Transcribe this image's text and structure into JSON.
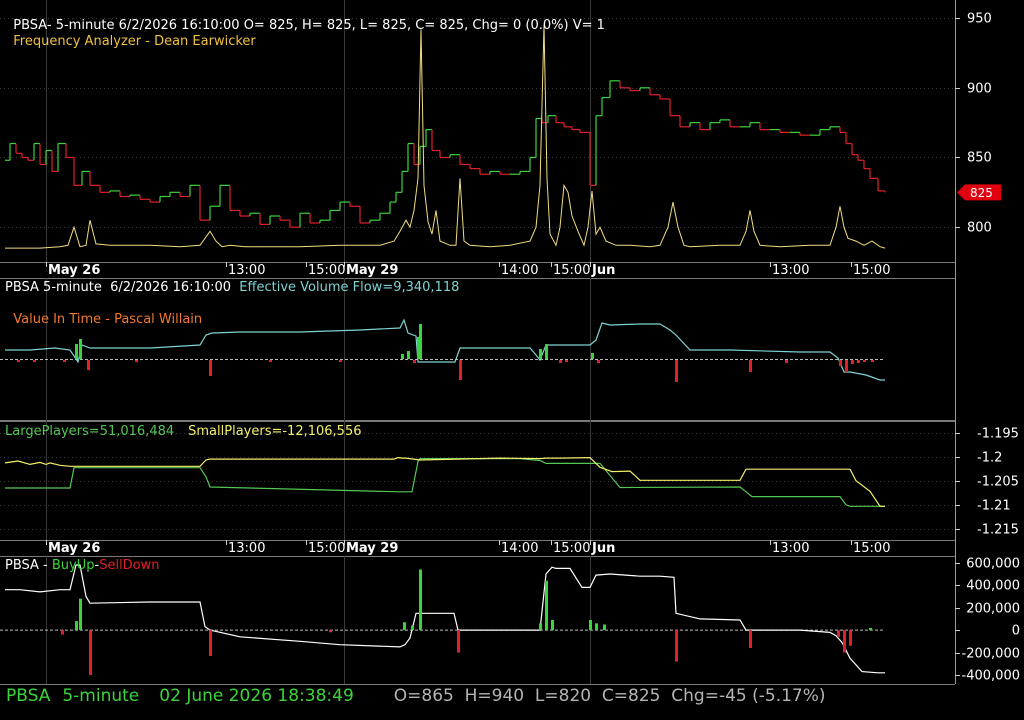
{
  "colors": {
    "background": "#000000",
    "grid": "#3a3a3a",
    "axis": "#cfcfcf",
    "up": "#3cd43c",
    "down": "#e0202a",
    "freq": "#f2dd80",
    "flow": "#7fd3d3",
    "small": "#f4f06a",
    "large": "#55c655",
    "white": "#ffffff",
    "header_title": "#ffffff",
    "header_sub": "#f0c040",
    "price_tag": "#e00010",
    "footer_green": "#3cd43c",
    "footer_grey": "#b4b4b4"
  },
  "panel1": {
    "title": "PBSA- 5-minute 6/2/2026 16:10:00 O= 825, H= 825, L= 825, C= 825, Chg= 0 (0.0%) V= 1",
    "subtitle": "Frequency Analyzer - Dean Earwicker"
  },
  "panel2": {
    "title_prefix": "PBSA 5-minute  6/2/2026 16:10:00  ",
    "title_value": "Effective Volume Flow=9,340,118",
    "subtitle": "Value In Time - Pascal Willain"
  },
  "panel3": {
    "large_label": "LargePlayers=51,016,484",
    "small_label": "SmallPlayers=-12,106,556"
  },
  "panel4": {
    "label_prefix": "PBSA - ",
    "label_up": "BuyUp",
    "label_sep": "-",
    "label_down": "SellDown"
  },
  "footer": {
    "symbol": "PBSA",
    "interval": "5-minute",
    "datetime": "02 June 2026 18:38:49",
    "stats": "O=865  H=940  L=820  C=825  Chg=-45 (-5.17%)"
  },
  "chart_data": [
    {
      "type": "line",
      "name": "price",
      "y_ticks": [
        950,
        900,
        850,
        800
      ],
      "ylim": [
        775,
        963
      ],
      "last_price_label": "825",
      "last_price": 825,
      "x_tick_labels": [
        "May 26",
        "13:00",
        "15:00",
        "May 29",
        "14:00",
        "15:00",
        "Jun",
        "13:00",
        "15:00"
      ],
      "x": [
        5,
        10,
        16,
        22,
        28,
        34,
        40,
        46,
        52,
        58,
        66,
        74,
        82,
        90,
        100,
        110,
        120,
        130,
        140,
        150,
        160,
        170,
        180,
        190,
        200,
        210,
        220,
        230,
        240,
        250,
        260,
        270,
        280,
        290,
        300,
        310,
        320,
        330,
        340,
        350,
        360,
        370,
        380,
        390,
        396,
        402,
        408,
        414,
        420,
        426,
        432,
        440,
        450,
        460,
        470,
        480,
        490,
        500,
        510,
        520,
        530,
        536,
        542,
        548,
        556,
        564,
        572,
        580,
        590,
        596,
        602,
        610,
        620,
        630,
        640,
        650,
        660,
        670,
        680,
        690,
        700,
        710,
        720,
        730,
        740,
        750,
        760,
        770,
        780,
        790,
        800,
        810,
        820,
        830,
        840,
        846,
        852,
        858,
        864,
        870,
        878,
        885
      ],
      "values": [
        848,
        860,
        853,
        850,
        848,
        860,
        845,
        855,
        840,
        860,
        850,
        830,
        840,
        830,
        825,
        826,
        822,
        823,
        820,
        818,
        822,
        825,
        822,
        830,
        805,
        815,
        830,
        812,
        808,
        810,
        802,
        808,
        805,
        800,
        810,
        803,
        805,
        812,
        818,
        815,
        803,
        805,
        810,
        818,
        825,
        840,
        860,
        845,
        858,
        870,
        855,
        850,
        852,
        845,
        842,
        838,
        840,
        838,
        838,
        840,
        850,
        878,
        875,
        880,
        875,
        872,
        870,
        868,
        830,
        880,
        893,
        905,
        900,
        898,
        900,
        895,
        892,
        880,
        872,
        875,
        870,
        875,
        877,
        872,
        872,
        875,
        870,
        870,
        868,
        868,
        866,
        866,
        870,
        872,
        868,
        860,
        852,
        848,
        842,
        835,
        826,
        825
      ]
    },
    {
      "type": "line",
      "name": "Frequency Analyzer",
      "x": [
        5,
        20,
        40,
        60,
        68,
        74,
        80,
        86,
        90,
        96,
        110,
        130,
        150,
        180,
        200,
        206,
        210,
        216,
        222,
        230,
        245,
        265,
        300,
        340,
        380,
        394,
        400,
        406,
        410,
        414,
        418,
        421,
        424,
        428,
        432,
        436,
        440,
        450,
        456,
        460,
        464,
        470,
        490,
        510,
        530,
        536,
        540,
        544,
        547,
        550,
        556,
        560,
        564,
        568,
        572,
        578,
        584,
        588,
        592,
        596,
        600,
        606,
        616,
        630,
        650,
        660,
        668,
        673,
        678,
        684,
        690,
        720,
        740,
        746,
        750,
        754,
        760,
        780,
        810,
        830,
        836,
        840,
        844,
        848,
        856,
        864,
        872,
        880,
        885
      ],
      "values": [
        785,
        785,
        785,
        786,
        787,
        800,
        786,
        787,
        805,
        788,
        787,
        787,
        787,
        786,
        787,
        793,
        797,
        790,
        786,
        787,
        786,
        786,
        786,
        787,
        787,
        790,
        797,
        805,
        800,
        812,
        835,
        942,
        830,
        804,
        795,
        812,
        790,
        787,
        787,
        835,
        790,
        787,
        786,
        787,
        790,
        800,
        830,
        945,
        835,
        795,
        787,
        800,
        830,
        825,
        808,
        797,
        787,
        800,
        826,
        795,
        800,
        790,
        787,
        787,
        786,
        787,
        800,
        818,
        800,
        787,
        786,
        787,
        787,
        797,
        812,
        797,
        787,
        786,
        787,
        787,
        800,
        815,
        800,
        792,
        790,
        787,
        790,
        786,
        785
      ]
    },
    {
      "type": "line",
      "name": "Effective Volume Flow",
      "x": [
        5,
        30,
        55,
        70,
        78,
        82,
        90,
        150,
        200,
        206,
        212,
        240,
        300,
        360,
        400,
        404,
        408,
        416,
        418,
        424,
        430,
        450,
        455,
        460,
        470,
        510,
        530,
        536,
        540,
        546,
        560,
        590,
        596,
        602,
        610,
        640,
        660,
        670,
        676,
        690,
        730,
        800,
        830,
        838,
        844,
        850,
        866,
        880,
        885
      ],
      "values": [
        350,
        350,
        348,
        350,
        362,
        345,
        348,
        348,
        345,
        335,
        333,
        332,
        332,
        330,
        328,
        320,
        333,
        336,
        362,
        362,
        362,
        362,
        362,
        348,
        348,
        348,
        348,
        355,
        360,
        345,
        345,
        345,
        340,
        323,
        325,
        324,
        324,
        330,
        335,
        350,
        350,
        352,
        352,
        358,
        372,
        372,
        375,
        380,
        380
      ]
    },
    {
      "type": "bar",
      "name": "flow volume bars",
      "x": [
        18,
        34,
        64,
        76,
        80,
        88,
        136,
        210,
        270,
        340,
        402,
        408,
        414,
        418,
        420,
        460,
        540,
        546,
        560,
        566,
        592,
        598,
        676,
        750,
        786,
        840,
        846,
        852,
        858,
        864,
        872
      ],
      "values": [
        -2,
        -2,
        -2,
        15,
        20,
        -10,
        -2,
        -16,
        -2,
        -2,
        5,
        8,
        -3,
        22,
        35,
        -20,
        10,
        15,
        -3,
        -2,
        6,
        -3,
        -22,
        -12,
        -3,
        -6,
        -12,
        -4,
        -3,
        -2,
        -2
      ]
    },
    {
      "type": "line",
      "name": "LargePlayers",
      "y_ticks": [
        -1.195,
        -1.2,
        -1.205,
        -1.21,
        -1.215
      ],
      "ylim": [
        -1.2172,
        -1.1925
      ],
      "x": [
        5,
        60,
        70,
        74,
        200,
        206,
        210,
        400,
        408,
        412,
        418,
        420,
        520,
        540,
        546,
        550,
        600,
        620,
        740,
        746,
        752,
        800,
        840,
        846,
        850,
        880,
        885
      ],
      "values": [
        -1.2064,
        -1.2064,
        -1.2064,
        -1.2022,
        -1.2022,
        -1.2041,
        -1.2062,
        -1.2072,
        -1.2072,
        -1.2072,
        -1.2009,
        -1.2003,
        -1.2003,
        -1.2007,
        -1.2013,
        -1.2013,
        -1.2013,
        -1.2063,
        -1.2062,
        -1.2072,
        -1.2082,
        -1.2082,
        -1.2082,
        -1.2099,
        -1.2102,
        -1.2102,
        -1.2102
      ]
    },
    {
      "type": "line",
      "name": "SmallPlayers",
      "x": [
        5,
        18,
        30,
        40,
        46,
        50,
        60,
        70,
        90,
        150,
        200,
        206,
        210,
        350,
        394,
        398,
        402,
        406,
        420,
        500,
        540,
        546,
        560,
        590,
        600,
        612,
        630,
        640,
        660,
        700,
        740,
        746,
        752,
        850,
        856,
        870,
        880,
        885
      ],
      "values": [
        -1.2012,
        -1.2008,
        -1.2015,
        -1.2011,
        -1.2015,
        -1.2012,
        -1.2017,
        -1.2019,
        -1.2019,
        -1.2019,
        -1.2019,
        -1.2006,
        -1.2004,
        -1.2004,
        -1.2004,
        -1.2001,
        -1.2002,
        -1.2002,
        -1.2006,
        -1.2002,
        -1.2003,
        -1.2002,
        -1.2002,
        -1.2001,
        -1.2021,
        -1.203,
        -1.2029,
        -1.2048,
        -1.2048,
        -1.2048,
        -1.2048,
        -1.2025,
        -1.2025,
        -1.2025,
        -1.2049,
        -1.2071,
        -1.2102,
        -1.2102
      ]
    },
    {
      "type": "line",
      "name": "BuyUp-SellDown",
      "y_ticks": [
        600000,
        400000,
        200000,
        0,
        -200000,
        -400000
      ],
      "ylim": [
        -480000,
        660000
      ],
      "x": [
        5,
        20,
        40,
        60,
        70,
        76,
        80,
        86,
        90,
        150,
        200,
        205,
        210,
        240,
        300,
        340,
        400,
        405,
        410,
        416,
        420,
        454,
        458,
        462,
        540,
        546,
        552,
        556,
        570,
        582,
        590,
        596,
        610,
        640,
        660,
        674,
        676,
        700,
        740,
        746,
        800,
        830,
        836,
        842,
        850,
        862,
        878,
        885
      ],
      "values": [
        360000,
        360000,
        340000,
        360000,
        360000,
        580000,
        580000,
        300000,
        240000,
        250000,
        250000,
        30000,
        0,
        -60000,
        -100000,
        -130000,
        -150000,
        -130000,
        -70000,
        150000,
        150000,
        150000,
        0,
        0,
        0,
        500000,
        560000,
        550000,
        550000,
        380000,
        380000,
        490000,
        500000,
        480000,
        480000,
        470000,
        150000,
        100000,
        90000,
        0,
        0,
        -20000,
        -50000,
        -110000,
        -250000,
        -370000,
        -380000,
        -380000
      ]
    },
    {
      "type": "bar",
      "name": "BuyUp-SellDown bars",
      "x": [
        62,
        76,
        80,
        90,
        210,
        330,
        404,
        412,
        420,
        458,
        540,
        546,
        552,
        590,
        596,
        604,
        676,
        750,
        838,
        844,
        850,
        870
      ],
      "values": [
        -40000,
        80000,
        280000,
        -400000,
        -230000,
        -20000,
        70000,
        40000,
        540000,
        -200000,
        60000,
        440000,
        90000,
        90000,
        60000,
        50000,
        -280000,
        -160000,
        -60000,
        -200000,
        -140000,
        20000
      ]
    }
  ]
}
